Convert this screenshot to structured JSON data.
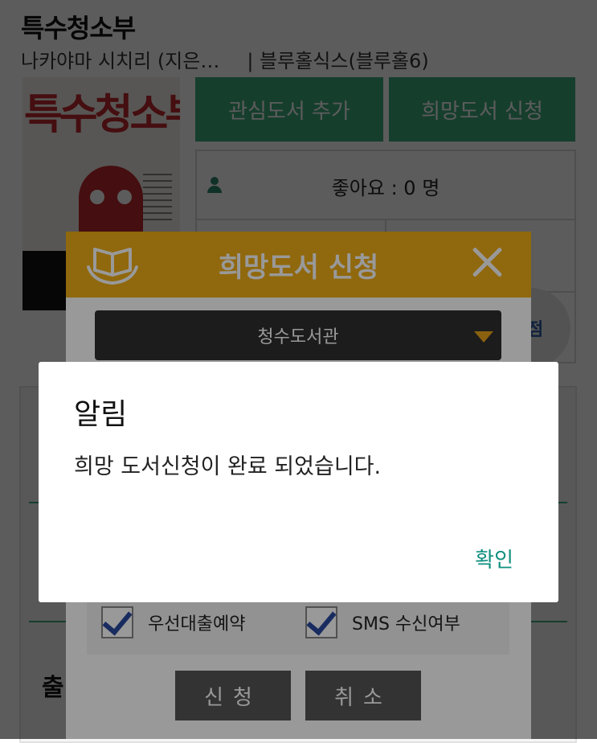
{
  "book": {
    "title": "특수청소부",
    "author": "나카야마 시치리 (지은…",
    "publisher": "| 블루홀식스(블루홀6)",
    "cover_title": "특수청소부"
  },
  "actions": {
    "wishlist_label": "관심도서 추가",
    "request_label": "희망도서 신청"
  },
  "likes": {
    "label": "좋아요 : 0 명"
  },
  "score": {
    "label": "점"
  },
  "section": {
    "partial_label": "출"
  },
  "request_modal": {
    "title": "희망도서 신청",
    "library_selected": "청수도서관",
    "checkbox_priority": "우선대출예약",
    "checkbox_sms": "SMS 수신여부",
    "submit_label": "신청",
    "cancel_label": "취소"
  },
  "alert": {
    "title": "알림",
    "message": "희망 도서신청이 완료 되었습니다.",
    "ok_label": "확인"
  },
  "colors": {
    "green": "#3fae7f",
    "header_orange": "#f0ae16",
    "ok_text": "#0f8f7f"
  },
  "icons": {
    "modal_header": "book-in-hands-icon",
    "close": "close-icon",
    "person": "person-icon",
    "dropdown": "dropdown-caret-icon",
    "checkbox": "checkmark-icon"
  }
}
